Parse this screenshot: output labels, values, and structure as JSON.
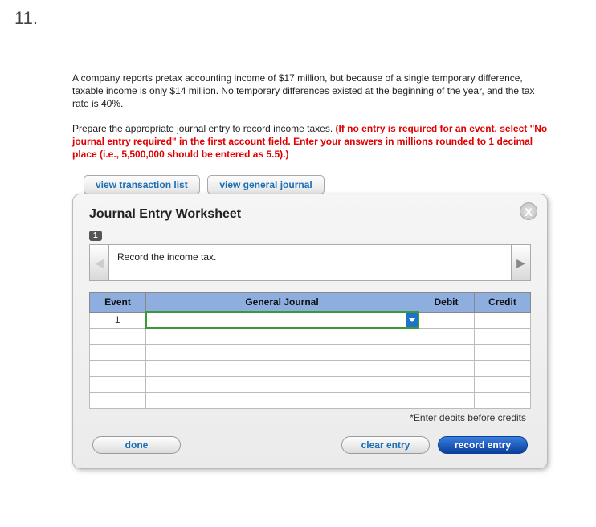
{
  "question_number": "11.",
  "problem_p1": "A company reports pretax accounting income of $17 million, but because of a single temporary difference, taxable income is only $14 million. No temporary differences existed at the beginning of the year, and the tax rate is 40%.",
  "problem_p2a": "Prepare the appropriate journal entry to record income taxes. ",
  "problem_p2b": "(If no entry is required for an event, select \"No journal entry required\" in the first account field. Enter your answers in millions rounded to 1 decimal place (i.e., 5,500,000 should be entered as 5.5).)",
  "tabs": {
    "transaction": "view transaction list",
    "journal": "view general journal"
  },
  "panel": {
    "title": "Journal Entry Worksheet",
    "step": "1",
    "instruction": "Record the income tax.",
    "headers": {
      "event": "Event",
      "gj": "General Journal",
      "debit": "Debit",
      "credit": "Credit"
    },
    "rows": [
      {
        "event": "1"
      },
      {
        "event": ""
      },
      {
        "event": ""
      },
      {
        "event": ""
      },
      {
        "event": ""
      },
      {
        "event": ""
      }
    ],
    "footnote": "*Enter debits before credits",
    "buttons": {
      "done": "done",
      "clear": "clear entry",
      "record": "record entry"
    }
  }
}
